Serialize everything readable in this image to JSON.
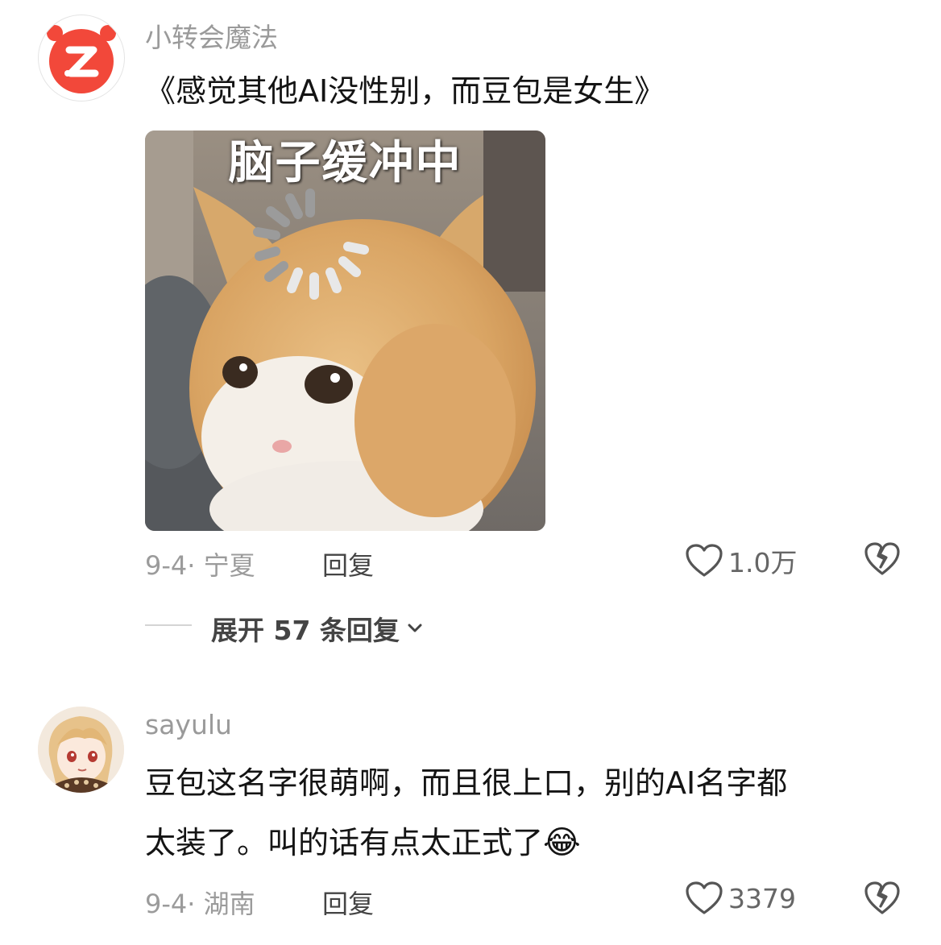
{
  "comments": [
    {
      "username": "小转会魔法",
      "text": "《感觉其他AI没性别，而豆包是女生》",
      "image_caption": "脑子缓冲中",
      "date": "9-4",
      "location": "宁夏",
      "reply_label": "回复",
      "likes": "1.0万",
      "expand_label": "展开 57 条回复"
    },
    {
      "username": "sayulu",
      "text_line1": "豆包这名字很萌啊，而且很上口，别的AI名字都",
      "text_line2": "太装了。叫的话有点太正式了",
      "emoji": "😂",
      "date": "9-4",
      "location": "湖南",
      "reply_label": "回复",
      "likes": "3379"
    }
  ],
  "colors": {
    "brand_red": "#f2483a",
    "meta_gray": "#9b9b9b",
    "text_dark": "#141414"
  },
  "icons": [
    "app-logo-icon",
    "heart-icon",
    "broken-heart-icon",
    "chevron-down-icon"
  ]
}
